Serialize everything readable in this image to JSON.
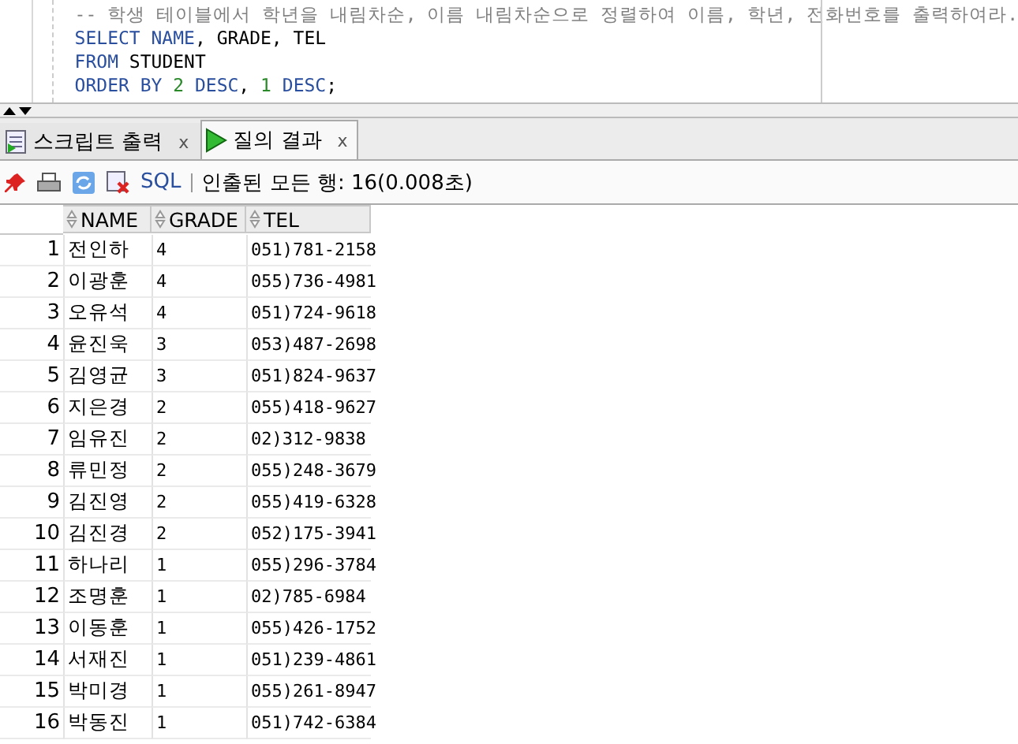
{
  "editor": {
    "lines": [
      [
        {
          "kind": "comment",
          "text": "-- 학생 테이블에서 학년을 내림차순, 이름 내림차순으로 정렬하여 이름, 학년, 전화번호를 출력하여라."
        }
      ],
      [
        {
          "kind": "keyword",
          "text": "SELECT NAME"
        },
        {
          "kind": "plain",
          "text": ", GRADE, TEL"
        }
      ],
      [
        {
          "kind": "keyword",
          "text": "FROM"
        },
        {
          "kind": "plain",
          "text": " STUDENT"
        }
      ],
      [
        {
          "kind": "keyword",
          "text": "ORDER BY"
        },
        {
          "kind": "number",
          "text": " 2"
        },
        {
          "kind": "keyword",
          "text": " DESC"
        },
        {
          "kind": "plain",
          "text": ","
        },
        {
          "kind": "number",
          "text": " 1"
        },
        {
          "kind": "keyword",
          "text": " DESC"
        },
        {
          "kind": "plain",
          "text": ";"
        }
      ]
    ]
  },
  "tabs": [
    {
      "label": "스크립트 출력",
      "close": "x",
      "kind": "script",
      "selected": false
    },
    {
      "label": "질의 결과",
      "close": "x",
      "kind": "run",
      "selected": true
    }
  ],
  "toolbar": {
    "sql": "SQL",
    "status": "인출된 모든 행: 16(0.008초)"
  },
  "table": {
    "columns": [
      "NAME",
      "GRADE",
      "TEL"
    ],
    "rows": [
      {
        "row": "1",
        "cells": [
          "전인하",
          "4",
          "051)781-2158"
        ]
      },
      {
        "row": "2",
        "cells": [
          "이광훈",
          "4",
          "055)736-4981"
        ]
      },
      {
        "row": "3",
        "cells": [
          "오유석",
          "4",
          "051)724-9618"
        ]
      },
      {
        "row": "4",
        "cells": [
          "윤진욱",
          "3",
          "053)487-2698"
        ]
      },
      {
        "row": "5",
        "cells": [
          "김영균",
          "3",
          "051)824-9637"
        ]
      },
      {
        "row": "6",
        "cells": [
          "지은경",
          "2",
          "055)418-9627"
        ]
      },
      {
        "row": "7",
        "cells": [
          "임유진",
          "2",
          "02)312-9838"
        ]
      },
      {
        "row": "8",
        "cells": [
          "류민정",
          "2",
          "055)248-3679"
        ]
      },
      {
        "row": "9",
        "cells": [
          "김진영",
          "2",
          "055)419-6328"
        ]
      },
      {
        "row": "10",
        "cells": [
          "김진경",
          "2",
          "052)175-3941"
        ]
      },
      {
        "row": "11",
        "cells": [
          "하나리",
          "1",
          "055)296-3784"
        ]
      },
      {
        "row": "12",
        "cells": [
          "조명훈",
          "1",
          "02)785-6984"
        ]
      },
      {
        "row": "13",
        "cells": [
          "이동훈",
          "1",
          "055)426-1752"
        ]
      },
      {
        "row": "14",
        "cells": [
          "서재진",
          "1",
          "051)239-4861"
        ]
      },
      {
        "row": "15",
        "cells": [
          "박미경",
          "1",
          "055)261-8947"
        ]
      },
      {
        "row": "16",
        "cells": [
          "박동진",
          "1",
          "051)742-6384"
        ]
      }
    ]
  }
}
